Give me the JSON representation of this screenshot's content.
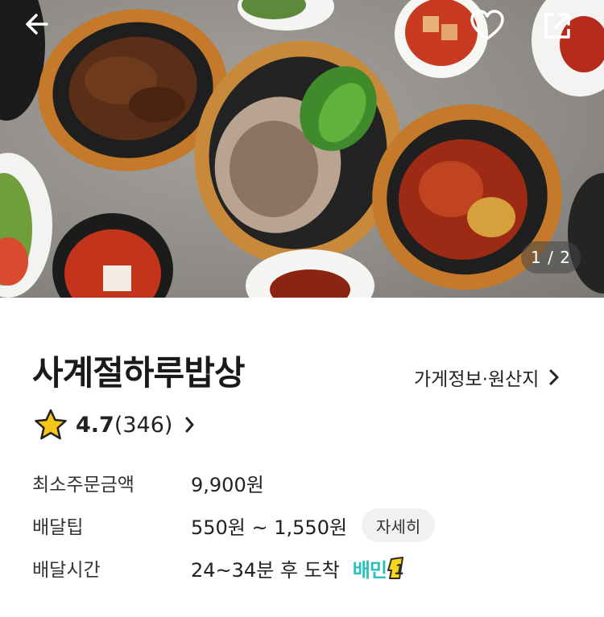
{
  "hero": {
    "page_indicator": "1 / 2",
    "icons": [
      "back-arrow-icon",
      "heart-icon",
      "share-icon"
    ]
  },
  "store": {
    "name": "사계절하루밥상",
    "info_link_label": "가게정보·원산지",
    "rating": "4.7",
    "review_count": "(346)"
  },
  "details": [
    {
      "label": "최소주문금액",
      "value": "9,900원"
    },
    {
      "label": "배달팁",
      "value": "550원 ~ 1,550원",
      "button": "자세히"
    },
    {
      "label": "배달시간",
      "value": "24~34분 후 도착",
      "badge_text": "배민",
      "badge_number": "1"
    }
  ],
  "colors": {
    "star": "#f5c518",
    "baemin_mint": "#2ac1bc",
    "badge_yellow": "#f7d51d"
  }
}
